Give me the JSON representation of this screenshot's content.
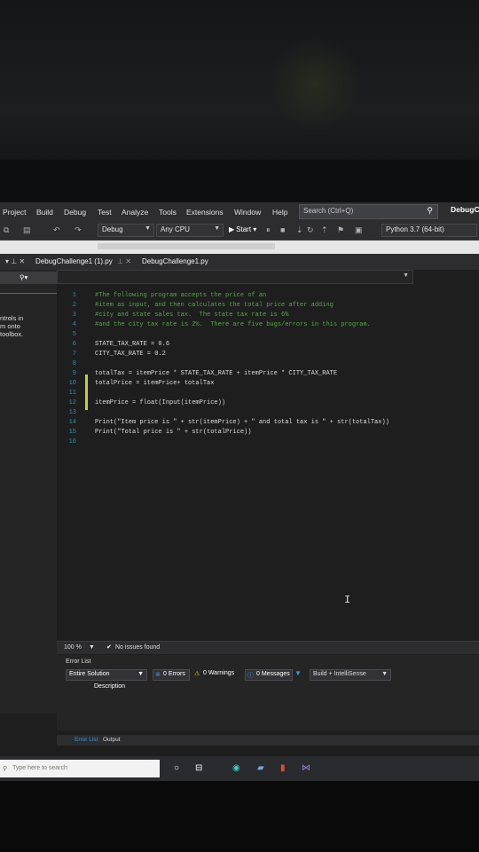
{
  "menubar": {
    "items": [
      "Project",
      "Build",
      "Debug",
      "Test",
      "Analyze",
      "Tools",
      "Extensions",
      "Window",
      "Help"
    ],
    "search_placeholder": "Search (Ctrl+Q)",
    "title": "DebugCh"
  },
  "toolbar": {
    "config": "Debug",
    "platform": "Any CPU",
    "start_label": "Start",
    "python_env": "Python 3.7 (64-bit)"
  },
  "tabs": {
    "inactive": "DebugChallenge1 (1).py",
    "active": "DebugChallenge1.py"
  },
  "left_panel": {
    "lines": [
      "ntrols in",
      "m onto",
      "toolbox."
    ]
  },
  "editor": {
    "lines": [
      {
        "n": "1",
        "text": "#The following program accepts the price of an",
        "kind": "comment"
      },
      {
        "n": "2",
        "text": "#item as input, and then calculates the total price after adding",
        "kind": "comment"
      },
      {
        "n": "3",
        "text": "#city and state sales tax.  The state tax rate is 6%",
        "kind": "comment"
      },
      {
        "n": "4",
        "text": "#and the city tax rate is 2%.  There are five bugs/errors in this program.",
        "kind": "comment"
      },
      {
        "n": "5",
        "text": "",
        "kind": "plain"
      },
      {
        "n": "6",
        "text": "STATE_TAX_RATE = 0.6",
        "kind": "plain"
      },
      {
        "n": "7",
        "text": "CITY_TAX_RATE = 0.2",
        "kind": "plain"
      },
      {
        "n": "8",
        "text": "",
        "kind": "plain"
      },
      {
        "n": "9",
        "text": "totalTax = itemPrice * STATE_TAX_RATE + itemPrice * CITY_TAX_RATE",
        "kind": "plain"
      },
      {
        "n": "10",
        "text": "totalPrice = itemPrice+ totalTax",
        "kind": "plain"
      },
      {
        "n": "11",
        "text": "",
        "kind": "plain"
      },
      {
        "n": "12",
        "text": "itemPrice = float(Input(itemPrice))",
        "kind": "plain"
      },
      {
        "n": "13",
        "text": "",
        "kind": "plain"
      },
      {
        "n": "14",
        "text": "Print(\"Item price is \" + str(itemPrice) + \" and total tax is \" + str(totalTax))",
        "kind": "plain"
      },
      {
        "n": "15",
        "text": "Print(\"Total price is \" + str(totalPrice))",
        "kind": "plain"
      },
      {
        "n": "16",
        "text": "",
        "kind": "plain"
      }
    ]
  },
  "status": {
    "zoom": "100 %",
    "issues": "No issues found"
  },
  "error_list": {
    "title": "Error List",
    "scope": "Entire Solution",
    "errors": "0 Errors",
    "warnings": "0 Warnings",
    "messages": "0 Messages",
    "source": "Build + IntelliSense",
    "column_description": "Description"
  },
  "bottom_tabs": {
    "error_list": "Error List",
    "output": "Output"
  },
  "taskbar": {
    "search_placeholder": "Type here to search"
  },
  "colors": {
    "comment": "#57a64a",
    "line_number": "#2b91af",
    "change_marker": "#c7d12a",
    "ide_background": "#1e1e1e"
  }
}
